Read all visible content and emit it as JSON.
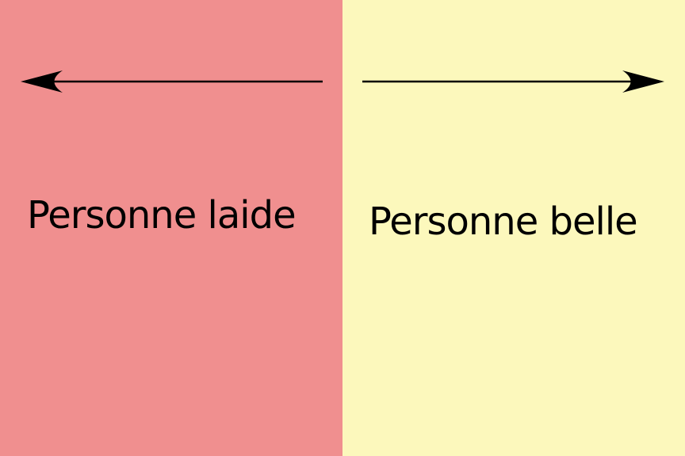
{
  "colors": {
    "left_background": "#f08f8f",
    "right_background": "#fcf8bc",
    "arrow": "#000000",
    "text": "#000000"
  },
  "left_panel": {
    "label": "Personne laide",
    "arrow_icon": "arrow-left-icon"
  },
  "right_panel": {
    "label": "Personne belle",
    "arrow_icon": "arrow-right-icon"
  }
}
